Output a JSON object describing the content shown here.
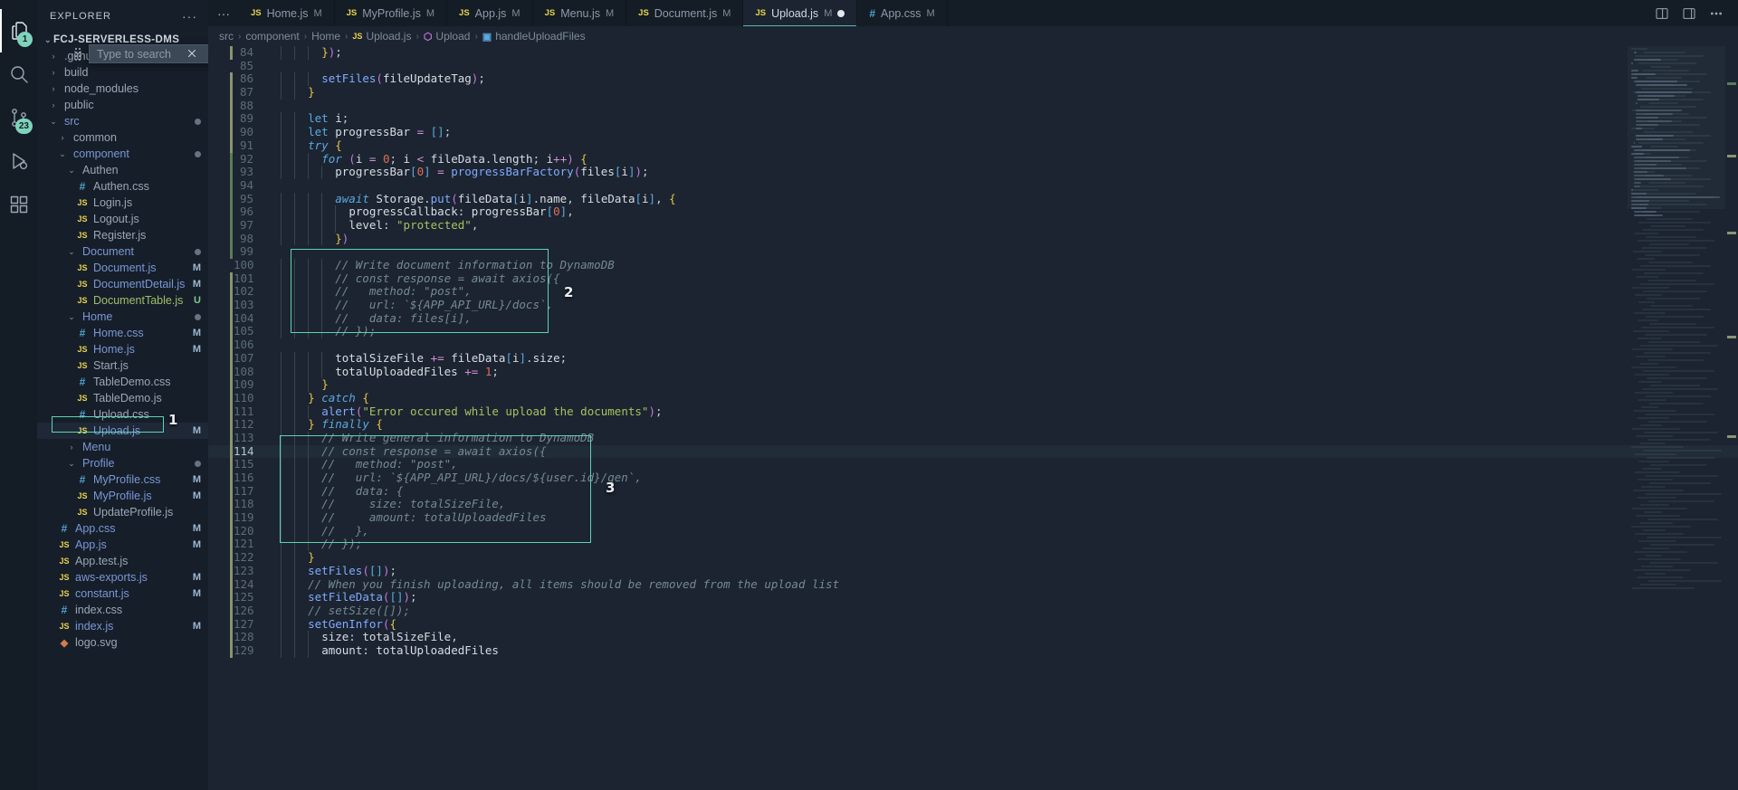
{
  "activity_bar": {
    "items": [
      {
        "name": "explorer",
        "icon": "files-icon",
        "badge": "1",
        "active": true
      },
      {
        "name": "search",
        "icon": "search-icon",
        "badge": "",
        "active": false
      },
      {
        "name": "source-control",
        "icon": "source-control-icon",
        "badge": "23",
        "active": false
      },
      {
        "name": "run-and-debug",
        "icon": "debug-icon",
        "badge": "",
        "active": false
      },
      {
        "name": "extensions",
        "icon": "extensions-icon",
        "badge": "",
        "active": false
      }
    ]
  },
  "sidebar": {
    "title": "EXPLORER",
    "more_actions": "···",
    "root": "FCJ-SERVERLESS-DMS",
    "search": {
      "placeholder": "Type to search",
      "value": "",
      "filter_icon": "filter-icon",
      "close_icon": "close-icon"
    },
    "tree": [
      {
        "label": ".github",
        "type": "folder",
        "depth": 1,
        "expanded": false,
        "state": "",
        "color": "norm",
        "hidden_by_overlay": true
      },
      {
        "label": "build",
        "type": "folder",
        "depth": 1,
        "expanded": false,
        "state": "",
        "color": "norm"
      },
      {
        "label": "node_modules",
        "type": "folder",
        "depth": 1,
        "expanded": false,
        "state": "",
        "color": "norm"
      },
      {
        "label": "public",
        "type": "folder",
        "depth": 1,
        "expanded": false,
        "state": "",
        "color": "norm"
      },
      {
        "label": "src",
        "type": "folder",
        "depth": 1,
        "expanded": true,
        "state": "dot",
        "color": "mod"
      },
      {
        "label": "common",
        "type": "folder",
        "depth": 2,
        "expanded": false,
        "state": "",
        "color": "norm"
      },
      {
        "label": "component",
        "type": "folder",
        "depth": 2,
        "expanded": true,
        "state": "dot",
        "color": "mod"
      },
      {
        "label": "Authen",
        "type": "folder",
        "depth": 3,
        "expanded": true,
        "state": "",
        "color": "plain"
      },
      {
        "label": "Authen.css",
        "type": "css",
        "depth": 4,
        "state": "",
        "color": "norm"
      },
      {
        "label": "Login.js",
        "type": "js",
        "depth": 4,
        "state": "",
        "color": "norm"
      },
      {
        "label": "Logout.js",
        "type": "js",
        "depth": 4,
        "state": "",
        "color": "norm"
      },
      {
        "label": "Register.js",
        "type": "js",
        "depth": 4,
        "state": "",
        "color": "norm"
      },
      {
        "label": "Document",
        "type": "folder",
        "depth": 3,
        "expanded": true,
        "state": "dot",
        "color": "mod"
      },
      {
        "label": "Document.js",
        "type": "js",
        "depth": 4,
        "state": "M",
        "color": "mod"
      },
      {
        "label": "DocumentDetail.js",
        "type": "js",
        "depth": 4,
        "state": "M",
        "color": "mod"
      },
      {
        "label": "DocumentTable.js",
        "type": "js",
        "depth": 4,
        "state": "U",
        "color": "new"
      },
      {
        "label": "Home",
        "type": "folder",
        "depth": 3,
        "expanded": true,
        "state": "dot",
        "color": "mod"
      },
      {
        "label": "Home.css",
        "type": "css",
        "depth": 4,
        "state": "M",
        "color": "mod"
      },
      {
        "label": "Home.js",
        "type": "js",
        "depth": 4,
        "state": "M",
        "color": "mod"
      },
      {
        "label": "Start.js",
        "type": "js",
        "depth": 4,
        "state": "",
        "color": "norm"
      },
      {
        "label": "TableDemo.css",
        "type": "css",
        "depth": 4,
        "state": "",
        "color": "norm"
      },
      {
        "label": "TableDemo.js",
        "type": "js",
        "depth": 4,
        "state": "",
        "color": "norm"
      },
      {
        "label": "Upload.css",
        "type": "css",
        "depth": 4,
        "state": "",
        "color": "norm"
      },
      {
        "label": "Upload.js",
        "type": "js",
        "depth": 4,
        "state": "M",
        "color": "mod",
        "selected": true,
        "annotated": "1"
      },
      {
        "label": "Menu",
        "type": "folder",
        "depth": 3,
        "expanded": false,
        "state": "",
        "color": "mod"
      },
      {
        "label": "Profile",
        "type": "folder",
        "depth": 3,
        "expanded": true,
        "state": "dot",
        "color": "mod"
      },
      {
        "label": "MyProfile.css",
        "type": "css",
        "depth": 4,
        "state": "M",
        "color": "mod"
      },
      {
        "label": "MyProfile.js",
        "type": "js",
        "depth": 4,
        "state": "M",
        "color": "mod"
      },
      {
        "label": "UpdateProfile.js",
        "type": "js",
        "depth": 4,
        "state": "",
        "color": "norm"
      },
      {
        "label": "App.css",
        "type": "css",
        "depth": 2,
        "state": "M",
        "color": "mod"
      },
      {
        "label": "App.js",
        "type": "js",
        "depth": 2,
        "state": "M",
        "color": "mod"
      },
      {
        "label": "App.test.js",
        "type": "js",
        "depth": 2,
        "state": "",
        "color": "norm"
      },
      {
        "label": "aws-exports.js",
        "type": "js",
        "depth": 2,
        "state": "M",
        "color": "mod"
      },
      {
        "label": "constant.js",
        "type": "js",
        "depth": 2,
        "state": "M",
        "color": "mod"
      },
      {
        "label": "index.css",
        "type": "css",
        "depth": 2,
        "state": "",
        "color": "norm"
      },
      {
        "label": "index.js",
        "type": "js",
        "depth": 2,
        "state": "M",
        "color": "mod"
      },
      {
        "label": "logo.svg",
        "type": "svg",
        "depth": 2,
        "state": "",
        "color": "norm"
      }
    ]
  },
  "tabs": {
    "overflow_icon": "···",
    "items": [
      {
        "label": "Home.js",
        "icon": "js-file-icon",
        "state": "M",
        "active": false,
        "dirty": false
      },
      {
        "label": "MyProfile.js",
        "icon": "js-file-icon",
        "state": "M",
        "active": false,
        "dirty": false
      },
      {
        "label": "App.js",
        "icon": "js-file-icon",
        "state": "M",
        "active": false,
        "dirty": false
      },
      {
        "label": "Menu.js",
        "icon": "js-file-icon",
        "state": "M",
        "active": false,
        "dirty": false
      },
      {
        "label": "Document.js",
        "icon": "js-file-icon",
        "state": "M",
        "active": false,
        "dirty": false
      },
      {
        "label": "Upload.js",
        "icon": "js-file-icon",
        "state": "M",
        "active": true,
        "dirty": true
      },
      {
        "label": "App.css",
        "icon": "css-file-icon",
        "state": "M",
        "active": false,
        "dirty": false
      }
    ],
    "actions": [
      {
        "name": "split-editor-right-icon"
      },
      {
        "name": "toggle-panel-icon"
      },
      {
        "name": "more-actions-icon"
      }
    ]
  },
  "breadcrumb": {
    "items": [
      {
        "label": "src",
        "icon": ""
      },
      {
        "label": "component",
        "icon": ""
      },
      {
        "label": "Home",
        "icon": ""
      },
      {
        "label": "Upload.js",
        "icon": "js-file-icon"
      },
      {
        "label": "Upload",
        "icon": "react-component-icon"
      },
      {
        "label": "handleUploadFiles",
        "icon": "method-icon"
      }
    ],
    "separator": "›"
  },
  "annotations": [
    {
      "id": "1",
      "target": "sidebar-upload-js"
    },
    {
      "id": "2",
      "target": "code-comment-block-dynamodb-docs"
    },
    {
      "id": "3",
      "target": "code-comment-block-dynamodb-gen"
    }
  ],
  "editor": {
    "language": "javascript",
    "current_line": 114,
    "first_visible_line": 84,
    "lines": [
      {
        "n": 84,
        "text": "      });",
        "gutter": "mod",
        "indent": 3
      },
      {
        "n": 85,
        "text": "",
        "gutter": "",
        "indent": 0
      },
      {
        "n": 86,
        "text": "      setFiles(fileUpdateTag);",
        "gutter": "mod",
        "indent": 3
      },
      {
        "n": 87,
        "text": "    }",
        "gutter": "mod",
        "indent": 2
      },
      {
        "n": 88,
        "text": "",
        "gutter": "mod",
        "indent": 0
      },
      {
        "n": 89,
        "text": "    let i;",
        "gutter": "mod",
        "indent": 2
      },
      {
        "n": 90,
        "text": "    let progressBar = [];",
        "gutter": "mod",
        "indent": 2
      },
      {
        "n": 91,
        "text": "    try {",
        "gutter": "mod",
        "indent": 2
      },
      {
        "n": 92,
        "text": "      for (i = 0; i < fileData.length; i++) {",
        "gutter": "add",
        "indent": 3
      },
      {
        "n": 93,
        "text": "        progressBar[0] = progressBarFactory(files[i]);",
        "gutter": "add",
        "indent": 4
      },
      {
        "n": 94,
        "text": "",
        "gutter": "add",
        "indent": 0
      },
      {
        "n": 95,
        "text": "        await Storage.put(fileData[i].name, fileData[i], {",
        "gutter": "add",
        "indent": 4
      },
      {
        "n": 96,
        "text": "          progressCallback: progressBar[0],",
        "gutter": "add",
        "indent": 5
      },
      {
        "n": 97,
        "text": "          level: \"protected\",",
        "gutter": "add",
        "indent": 5
      },
      {
        "n": 98,
        "text": "        })",
        "gutter": "add",
        "indent": 4
      },
      {
        "n": 99,
        "text": "",
        "gutter": "add",
        "indent": 0
      },
      {
        "n": 100,
        "text": "        // Write document information to DynamoDB",
        "gutter": "",
        "indent": 4,
        "comment": true
      },
      {
        "n": 101,
        "text": "        // const response = await axios({",
        "gutter": "mod",
        "indent": 4,
        "comment": true
      },
      {
        "n": 102,
        "text": "        //   method: \"post\",",
        "gutter": "mod",
        "indent": 4,
        "comment": true
      },
      {
        "n": 103,
        "text": "        //   url: `${APP_API_URL}/docs`,",
        "gutter": "mod",
        "indent": 4,
        "comment": true
      },
      {
        "n": 104,
        "text": "        //   data: files[i],",
        "gutter": "mod",
        "indent": 4,
        "comment": true
      },
      {
        "n": 105,
        "text": "        // });",
        "gutter": "mod",
        "indent": 4,
        "comment": true
      },
      {
        "n": 106,
        "text": "",
        "gutter": "mod",
        "indent": 0
      },
      {
        "n": 107,
        "text": "        totalSizeFile += fileData[i].size;",
        "gutter": "mod",
        "indent": 4
      },
      {
        "n": 108,
        "text": "        totalUploadedFiles += 1;",
        "gutter": "mod",
        "indent": 4
      },
      {
        "n": 109,
        "text": "      }",
        "gutter": "mod",
        "indent": 3
      },
      {
        "n": 110,
        "text": "    } catch {",
        "gutter": "mod",
        "indent": 2
      },
      {
        "n": 111,
        "text": "      alert(\"Error occured while upload the documents\");",
        "gutter": "mod",
        "indent": 3
      },
      {
        "n": 112,
        "text": "    } finally {",
        "gutter": "mod",
        "indent": 2
      },
      {
        "n": 113,
        "text": "      // Write general information to DynamoDB",
        "gutter": "mod",
        "indent": 3,
        "comment": true
      },
      {
        "n": 114,
        "text": "      // const response = await axios({",
        "gutter": "mod",
        "indent": 3,
        "comment": true
      },
      {
        "n": 115,
        "text": "      //   method: \"post\",",
        "gutter": "mod",
        "indent": 3,
        "comment": true
      },
      {
        "n": 116,
        "text": "      //   url: `${APP_API_URL}/docs/${user.id}/gen`,",
        "gutter": "mod",
        "indent": 3,
        "comment": true
      },
      {
        "n": 117,
        "text": "      //   data: {",
        "gutter": "mod",
        "indent": 3,
        "comment": true
      },
      {
        "n": 118,
        "text": "      //     size: totalSizeFile,",
        "gutter": "mod",
        "indent": 3,
        "comment": true
      },
      {
        "n": 119,
        "text": "      //     amount: totalUploadedFiles",
        "gutter": "mod",
        "indent": 3,
        "comment": true
      },
      {
        "n": 120,
        "text": "      //   },",
        "gutter": "mod",
        "indent": 3,
        "comment": true
      },
      {
        "n": 121,
        "text": "      // });",
        "gutter": "mod",
        "indent": 3,
        "comment": true
      },
      {
        "n": 122,
        "text": "    }",
        "gutter": "mod",
        "indent": 2
      },
      {
        "n": 123,
        "text": "    setFiles([]);",
        "gutter": "mod",
        "indent": 2
      },
      {
        "n": 124,
        "text": "    // When you finish uploading, all items should be removed from the upload list",
        "gutter": "mod",
        "indent": 2,
        "comment": true
      },
      {
        "n": 125,
        "text": "    setFileData([]);",
        "gutter": "mod",
        "indent": 2
      },
      {
        "n": 126,
        "text": "    // setSize([]);",
        "gutter": "mod",
        "indent": 2,
        "comment": true
      },
      {
        "n": 127,
        "text": "    setGenInfor({",
        "gutter": "mod",
        "indent": 2
      },
      {
        "n": 128,
        "text": "      size: totalSizeFile,",
        "gutter": "mod",
        "indent": 3
      },
      {
        "n": 129,
        "text": "      amount: totalUploadedFiles",
        "gutter": "mod",
        "indent": 3
      }
    ]
  },
  "colors": {
    "accent": "#57b6ae",
    "annotation": "#5fd3b2",
    "background": "#1b2430",
    "sidebar_bg": "#161e29",
    "activity_bg": "#141c26",
    "modified": "#7a97d6",
    "untracked": "#9fbf6b",
    "comment": "#768a90",
    "string": "#a5c261",
    "keyword": "#5ba9e0"
  }
}
